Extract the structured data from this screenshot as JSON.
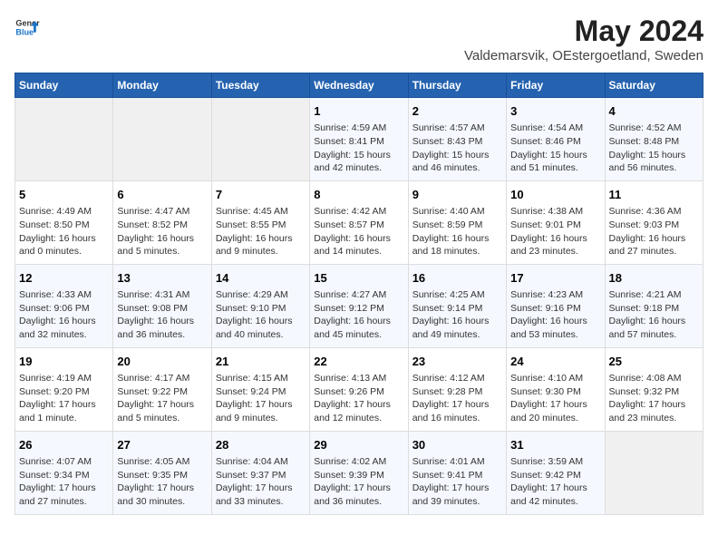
{
  "header": {
    "logo_general": "General",
    "logo_blue": "Blue",
    "title": "May 2024",
    "subtitle": "Valdemarsvik, OEstergoetland, Sweden"
  },
  "days_of_week": [
    "Sunday",
    "Monday",
    "Tuesday",
    "Wednesday",
    "Thursday",
    "Friday",
    "Saturday"
  ],
  "weeks": [
    [
      {
        "day": "",
        "sunrise": "",
        "sunset": "",
        "daylight": ""
      },
      {
        "day": "",
        "sunrise": "",
        "sunset": "",
        "daylight": ""
      },
      {
        "day": "",
        "sunrise": "",
        "sunset": "",
        "daylight": ""
      },
      {
        "day": "1",
        "sunrise": "Sunrise: 4:59 AM",
        "sunset": "Sunset: 8:41 PM",
        "daylight": "Daylight: 15 hours and 42 minutes."
      },
      {
        "day": "2",
        "sunrise": "Sunrise: 4:57 AM",
        "sunset": "Sunset: 8:43 PM",
        "daylight": "Daylight: 15 hours and 46 minutes."
      },
      {
        "day": "3",
        "sunrise": "Sunrise: 4:54 AM",
        "sunset": "Sunset: 8:46 PM",
        "daylight": "Daylight: 15 hours and 51 minutes."
      },
      {
        "day": "4",
        "sunrise": "Sunrise: 4:52 AM",
        "sunset": "Sunset: 8:48 PM",
        "daylight": "Daylight: 15 hours and 56 minutes."
      }
    ],
    [
      {
        "day": "5",
        "sunrise": "Sunrise: 4:49 AM",
        "sunset": "Sunset: 8:50 PM",
        "daylight": "Daylight: 16 hours and 0 minutes."
      },
      {
        "day": "6",
        "sunrise": "Sunrise: 4:47 AM",
        "sunset": "Sunset: 8:52 PM",
        "daylight": "Daylight: 16 hours and 5 minutes."
      },
      {
        "day": "7",
        "sunrise": "Sunrise: 4:45 AM",
        "sunset": "Sunset: 8:55 PM",
        "daylight": "Daylight: 16 hours and 9 minutes."
      },
      {
        "day": "8",
        "sunrise": "Sunrise: 4:42 AM",
        "sunset": "Sunset: 8:57 PM",
        "daylight": "Daylight: 16 hours and 14 minutes."
      },
      {
        "day": "9",
        "sunrise": "Sunrise: 4:40 AM",
        "sunset": "Sunset: 8:59 PM",
        "daylight": "Daylight: 16 hours and 18 minutes."
      },
      {
        "day": "10",
        "sunrise": "Sunrise: 4:38 AM",
        "sunset": "Sunset: 9:01 PM",
        "daylight": "Daylight: 16 hours and 23 minutes."
      },
      {
        "day": "11",
        "sunrise": "Sunrise: 4:36 AM",
        "sunset": "Sunset: 9:03 PM",
        "daylight": "Daylight: 16 hours and 27 minutes."
      }
    ],
    [
      {
        "day": "12",
        "sunrise": "Sunrise: 4:33 AM",
        "sunset": "Sunset: 9:06 PM",
        "daylight": "Daylight: 16 hours and 32 minutes."
      },
      {
        "day": "13",
        "sunrise": "Sunrise: 4:31 AM",
        "sunset": "Sunset: 9:08 PM",
        "daylight": "Daylight: 16 hours and 36 minutes."
      },
      {
        "day": "14",
        "sunrise": "Sunrise: 4:29 AM",
        "sunset": "Sunset: 9:10 PM",
        "daylight": "Daylight: 16 hours and 40 minutes."
      },
      {
        "day": "15",
        "sunrise": "Sunrise: 4:27 AM",
        "sunset": "Sunset: 9:12 PM",
        "daylight": "Daylight: 16 hours and 45 minutes."
      },
      {
        "day": "16",
        "sunrise": "Sunrise: 4:25 AM",
        "sunset": "Sunset: 9:14 PM",
        "daylight": "Daylight: 16 hours and 49 minutes."
      },
      {
        "day": "17",
        "sunrise": "Sunrise: 4:23 AM",
        "sunset": "Sunset: 9:16 PM",
        "daylight": "Daylight: 16 hours and 53 minutes."
      },
      {
        "day": "18",
        "sunrise": "Sunrise: 4:21 AM",
        "sunset": "Sunset: 9:18 PM",
        "daylight": "Daylight: 16 hours and 57 minutes."
      }
    ],
    [
      {
        "day": "19",
        "sunrise": "Sunrise: 4:19 AM",
        "sunset": "Sunset: 9:20 PM",
        "daylight": "Daylight: 17 hours and 1 minute."
      },
      {
        "day": "20",
        "sunrise": "Sunrise: 4:17 AM",
        "sunset": "Sunset: 9:22 PM",
        "daylight": "Daylight: 17 hours and 5 minutes."
      },
      {
        "day": "21",
        "sunrise": "Sunrise: 4:15 AM",
        "sunset": "Sunset: 9:24 PM",
        "daylight": "Daylight: 17 hours and 9 minutes."
      },
      {
        "day": "22",
        "sunrise": "Sunrise: 4:13 AM",
        "sunset": "Sunset: 9:26 PM",
        "daylight": "Daylight: 17 hours and 12 minutes."
      },
      {
        "day": "23",
        "sunrise": "Sunrise: 4:12 AM",
        "sunset": "Sunset: 9:28 PM",
        "daylight": "Daylight: 17 hours and 16 minutes."
      },
      {
        "day": "24",
        "sunrise": "Sunrise: 4:10 AM",
        "sunset": "Sunset: 9:30 PM",
        "daylight": "Daylight: 17 hours and 20 minutes."
      },
      {
        "day": "25",
        "sunrise": "Sunrise: 4:08 AM",
        "sunset": "Sunset: 9:32 PM",
        "daylight": "Daylight: 17 hours and 23 minutes."
      }
    ],
    [
      {
        "day": "26",
        "sunrise": "Sunrise: 4:07 AM",
        "sunset": "Sunset: 9:34 PM",
        "daylight": "Daylight: 17 hours and 27 minutes."
      },
      {
        "day": "27",
        "sunrise": "Sunrise: 4:05 AM",
        "sunset": "Sunset: 9:35 PM",
        "daylight": "Daylight: 17 hours and 30 minutes."
      },
      {
        "day": "28",
        "sunrise": "Sunrise: 4:04 AM",
        "sunset": "Sunset: 9:37 PM",
        "daylight": "Daylight: 17 hours and 33 minutes."
      },
      {
        "day": "29",
        "sunrise": "Sunrise: 4:02 AM",
        "sunset": "Sunset: 9:39 PM",
        "daylight": "Daylight: 17 hours and 36 minutes."
      },
      {
        "day": "30",
        "sunrise": "Sunrise: 4:01 AM",
        "sunset": "Sunset: 9:41 PM",
        "daylight": "Daylight: 17 hours and 39 minutes."
      },
      {
        "day": "31",
        "sunrise": "Sunrise: 3:59 AM",
        "sunset": "Sunset: 9:42 PM",
        "daylight": "Daylight: 17 hours and 42 minutes."
      },
      {
        "day": "",
        "sunrise": "",
        "sunset": "",
        "daylight": ""
      }
    ]
  ]
}
